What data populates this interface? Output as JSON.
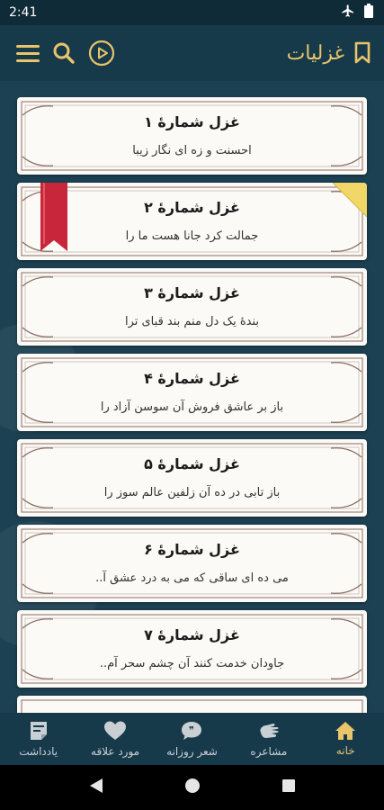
{
  "status_bar": {
    "time": "2:41"
  },
  "app_bar": {
    "title": "غزلیات"
  },
  "poems": [
    {
      "title": "غزل شمارهٔ ۱",
      "first_line": "احسنت و زه ای نگار زیبا"
    },
    {
      "title": "غزل شمارهٔ ۲",
      "first_line": "جمالت کرد جانا هست ما را",
      "bookmarked": true,
      "has_note": true
    },
    {
      "title": "غزل شمارهٔ ۳",
      "first_line": "بندهٔ یک دل منم بند قبای ترا"
    },
    {
      "title": "غزل شمارهٔ ۴",
      "first_line": "باز بر عاشق فروش آن سوسن آزاد را"
    },
    {
      "title": "غزل شمارهٔ ۵",
      "first_line": "باز تابی در ده آن زلفین عالم سوز را"
    },
    {
      "title": "غزل شمارهٔ ۶",
      "first_line": "می ده ای ساقی که می به درد عشق آ.."
    },
    {
      "title": "غزل شمارهٔ ۷",
      "first_line": "جاودان خدمت کنند آن چشم سحر آم.."
    }
  ],
  "bottom_nav": {
    "home": "خانه",
    "mushaere": "مشاعره",
    "daily_poem": "شعر روزانه",
    "favorites": "مورد علاقه",
    "notes": "یادداشت"
  },
  "colors": {
    "accent": "#e8c46a",
    "bar": "#173a4b",
    "ribbon": "#c8263a"
  }
}
